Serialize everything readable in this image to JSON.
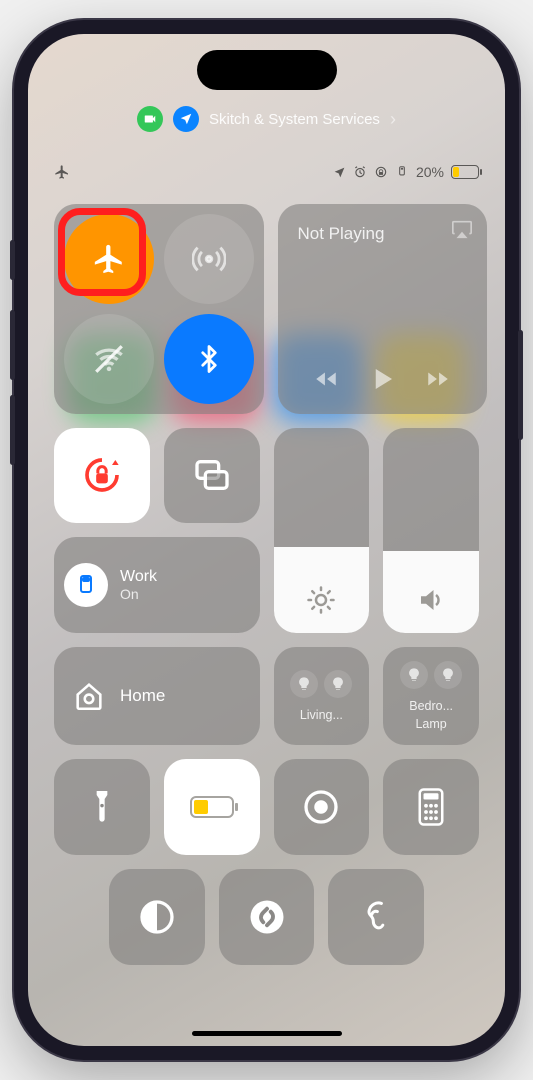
{
  "privacy": {
    "camera_active": true,
    "location_active": true,
    "label": "Skitch & System Services"
  },
  "status": {
    "airplane_mode": true,
    "location": true,
    "alarm": true,
    "orientation_lock": true,
    "focus": true,
    "battery_percent": "20%",
    "battery_level": 20,
    "battery_low_power_color": "#ffcc00"
  },
  "connectivity": {
    "airplane": {
      "on": true
    },
    "cellular": {
      "on": false
    },
    "wifi": {
      "on": false
    },
    "bluetooth": {
      "on": true
    }
  },
  "media": {
    "title": "Not Playing"
  },
  "orientation_lock": {
    "locked": true
  },
  "screen_mirroring": {
    "active": false
  },
  "focus": {
    "name": "Work",
    "state": "On"
  },
  "brightness": {
    "level": 0.42
  },
  "volume": {
    "level": 0.4
  },
  "home": {
    "label": "Home",
    "accessories": [
      {
        "label": "Living..."
      },
      {
        "label": "Bedro...",
        "sublabel": "Lamp"
      }
    ]
  },
  "shortcuts": {
    "flashlight": "Flashlight",
    "low_power": "Low Power Mode",
    "screen_record": "Screen Recording",
    "calculator": "Calculator",
    "dark_mode": "Dark Mode",
    "shazam": "Shazam",
    "hearing": "Hearing"
  },
  "annotation": {
    "highlight": "airplane-mode-toggle"
  }
}
